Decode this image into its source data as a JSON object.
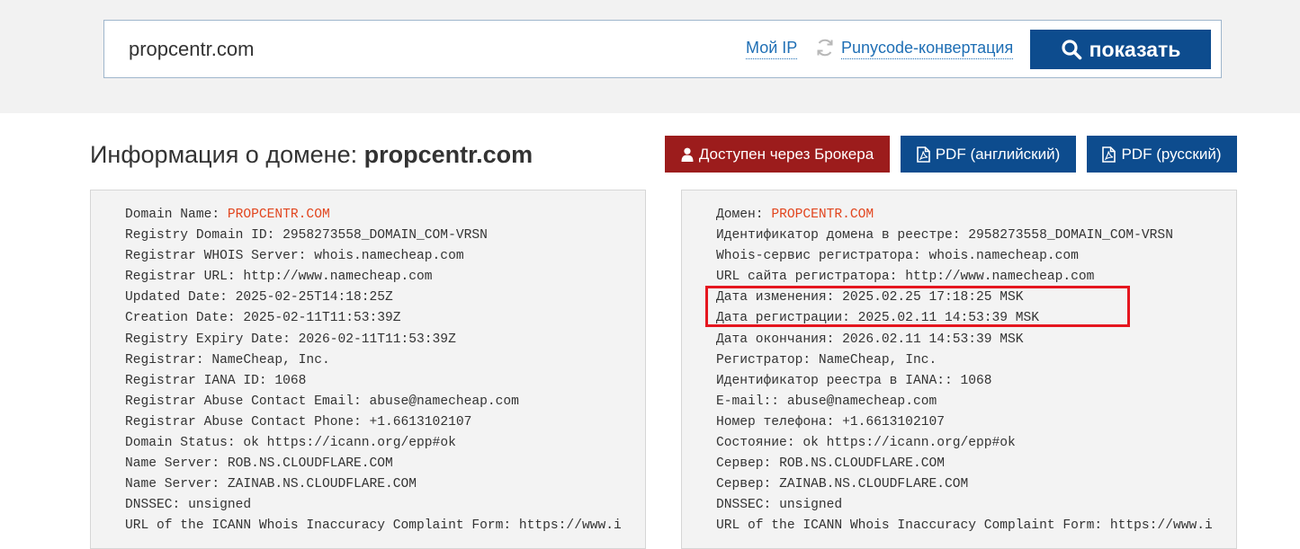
{
  "search": {
    "value": "propcentr.com",
    "my_ip": "Мой IP",
    "punycode": "Punycode-конвертация",
    "show_button": "показать"
  },
  "header": {
    "title_prefix": "Информация о домене:",
    "title_domain": "propcentr.com"
  },
  "actions": {
    "broker": "Доступен через Брокера",
    "pdf_en": "PDF (английский)",
    "pdf_ru": "PDF (русский)"
  },
  "whois_en": [
    {
      "label": "Domain Name: ",
      "value": "PROPCENTR.COM"
    },
    {
      "label": "Registry Domain ID: ",
      "value": "2958273558_DOMAIN_COM-VRSN"
    },
    {
      "label": "Registrar WHOIS Server: ",
      "value": "whois.namecheap.com"
    },
    {
      "label": "Registrar URL: ",
      "value": "http://www.namecheap.com"
    },
    {
      "label": "Updated Date: ",
      "value": "2025-02-25T14:18:25Z"
    },
    {
      "label": "Creation Date: ",
      "value": "2025-02-11T11:53:39Z"
    },
    {
      "label": "Registry Expiry Date: ",
      "value": "2026-02-11T11:53:39Z"
    },
    {
      "label": "Registrar: ",
      "value": "NameCheap, Inc."
    },
    {
      "label": "Registrar IANA ID: ",
      "value": "1068"
    },
    {
      "label": "Registrar Abuse Contact Email: ",
      "value": "abuse@namecheap.com"
    },
    {
      "label": "Registrar Abuse Contact Phone: ",
      "value": "+1.6613102107"
    },
    {
      "label": "Domain Status: ",
      "value": "ok https://icann.org/epp#ok"
    },
    {
      "label": "Name Server: ",
      "value": "ROB.NS.CLOUDFLARE.COM"
    },
    {
      "label": "Name Server: ",
      "value": "ZAINAB.NS.CLOUDFLARE.COM"
    },
    {
      "label": "DNSSEC: ",
      "value": "unsigned"
    },
    {
      "label": "URL of the ICANN Whois Inaccuracy Complaint Form: ",
      "value": "https://www.i"
    }
  ],
  "whois_ru": [
    {
      "label": "Домен: ",
      "value": "PROPCENTR.COM"
    },
    {
      "label": "Идентификатор домена в реестре: ",
      "value": "2958273558_DOMAIN_COM-VRSN"
    },
    {
      "label": "Whois-сервис регистратора: ",
      "value": "whois.namecheap.com"
    },
    {
      "label": "URL сайта регистратора: ",
      "value": "http://www.namecheap.com"
    },
    {
      "label": "Дата изменения: ",
      "value": "2025.02.25 17:18:25 MSK"
    },
    {
      "label": "Дата регистрации: ",
      "value": "2025.02.11 14:53:39 MSK"
    },
    {
      "label": "Дата окончания: ",
      "value": "2026.02.11 14:53:39 MSK"
    },
    {
      "label": "Регистратор: ",
      "value": "NameCheap, Inc."
    },
    {
      "label": "Идентификатор реестра в IANA:: ",
      "value": "1068"
    },
    {
      "label": "E-mail:: ",
      "value": "abuse@namecheap.com"
    },
    {
      "label": "Номер телефона: ",
      "value": "+1.6613102107"
    },
    {
      "label": "Состояние: ",
      "value": "ok https://icann.org/epp#ok"
    },
    {
      "label": "Сервер: ",
      "value": "ROB.NS.CLOUDFLARE.COM"
    },
    {
      "label": "Сервер: ",
      "value": "ZAINAB.NS.CLOUDFLARE.COM"
    },
    {
      "label": "DNSSEC: ",
      "value": "unsigned"
    },
    {
      "label": "URL of the ICANN Whois Inaccuracy Complaint Form: ",
      "value": "https://www.i"
    }
  ],
  "colors": {
    "accent": "#0d4c8e",
    "broker": "#9c1c1c",
    "domain_value": "#e2461f",
    "highlight": "#e5161f",
    "link": "#1f6fb5"
  }
}
